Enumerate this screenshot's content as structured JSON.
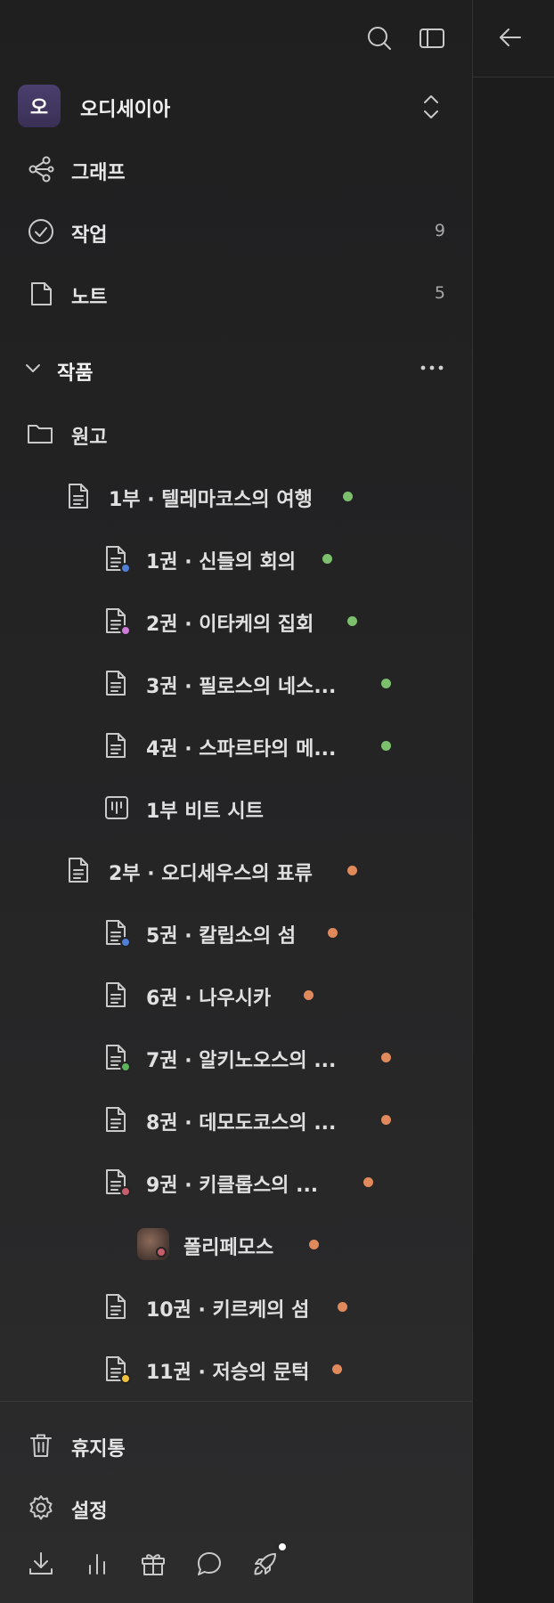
{
  "workspace": {
    "avatar_letter": "오",
    "name": "오디세이아"
  },
  "nav": [
    {
      "label": "그래프",
      "icon": "graph-icon",
      "count": ""
    },
    {
      "label": "작업",
      "icon": "task-check-icon",
      "count": "9"
    },
    {
      "label": "노트",
      "icon": "note-icon",
      "count": "5"
    }
  ],
  "section": {
    "title": "작품"
  },
  "tree": {
    "folder": {
      "label": "원고",
      "icon": "folder-icon"
    },
    "items": [
      {
        "label": "1부 · 텔레마코스의 여행",
        "icon": "document-icon",
        "status_color": "#7cc06e",
        "badge_color": ""
      },
      {
        "label": "1권 · 신들의 회의",
        "icon": "document-icon",
        "status_color": "#7cc06e",
        "badge_color": "#4f7fd8"
      },
      {
        "label": "2권 · 이타케의 집회",
        "icon": "document-icon",
        "status_color": "#7cc06e",
        "badge_color": "#cf7bd8"
      },
      {
        "label": "3권 · 필로스의 네스...",
        "icon": "document-icon",
        "status_color": "#7cc06e",
        "badge_color": ""
      },
      {
        "label": "4권 · 스파르타의 메...",
        "icon": "document-icon",
        "status_color": "#7cc06e",
        "badge_color": ""
      },
      {
        "label": "1부 비트 시트",
        "icon": "beat-sheet-icon",
        "status_color": "",
        "badge_color": ""
      },
      {
        "label": "2부 · 오디세우스의 표류",
        "icon": "document-icon",
        "status_color": "#e08a5c",
        "badge_color": ""
      },
      {
        "label": "5권 · 칼립소의 섬",
        "icon": "document-icon",
        "status_color": "#e08a5c",
        "badge_color": "#4f7fd8"
      },
      {
        "label": "6권 · 나우시카",
        "icon": "document-icon",
        "status_color": "#e08a5c",
        "badge_color": ""
      },
      {
        "label": "7권 · 알키노오스의 ...",
        "icon": "document-icon",
        "status_color": "#e08a5c",
        "badge_color": "#5bb35a"
      },
      {
        "label": "8권 · 데모도코스의 ...",
        "icon": "document-icon",
        "status_color": "#e08a5c",
        "badge_color": ""
      },
      {
        "label": "9권 · 키클롭스의 ...",
        "icon": "document-icon",
        "status_color": "#e08a5c",
        "badge_color": "#c75c6a"
      },
      {
        "label": "폴리페모스",
        "icon": "character-thumbnail",
        "status_color": "#e08a5c",
        "badge_color": "#c75c6a"
      },
      {
        "label": "10권 · 키르케의 섬",
        "icon": "document-icon",
        "status_color": "#e08a5c",
        "badge_color": ""
      },
      {
        "label": "11권 · 저승의 문턱",
        "icon": "document-icon",
        "status_color": "#e08a5c",
        "badge_color": "#f0c23a"
      }
    ]
  },
  "footer": [
    {
      "label": "휴지통",
      "icon": "trash-icon"
    },
    {
      "label": "설정",
      "icon": "gear-icon"
    }
  ],
  "tools": [
    "download-icon",
    "stats-icon",
    "gift-icon",
    "chat-icon",
    "rocket-icon"
  ]
}
